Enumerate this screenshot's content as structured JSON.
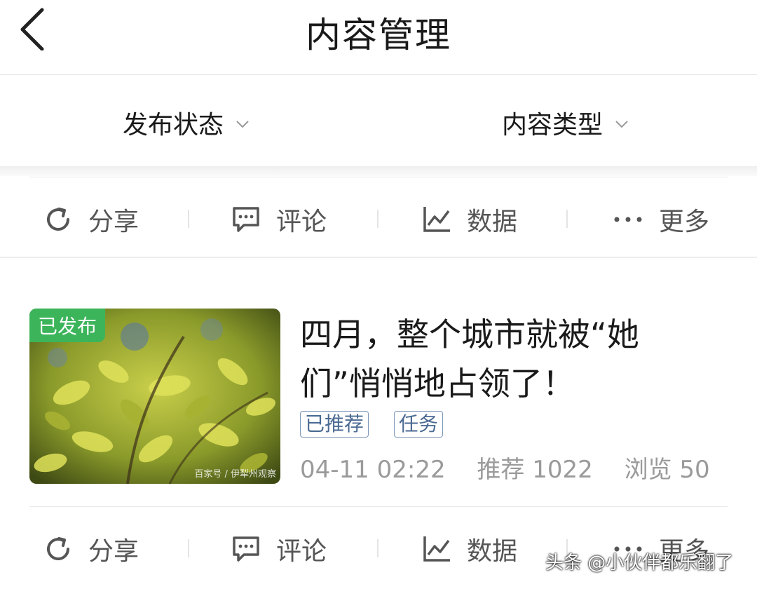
{
  "header": {
    "title": "内容管理"
  },
  "filters": [
    {
      "label": "发布状态"
    },
    {
      "label": "内容类型"
    }
  ],
  "actions": [
    {
      "label": "分享",
      "icon": "share-icon"
    },
    {
      "label": "评论",
      "icon": "comment-icon"
    },
    {
      "label": "数据",
      "icon": "chart-icon"
    },
    {
      "label": "更多",
      "icon": "more-icon"
    }
  ],
  "article": {
    "status_badge": "已发布",
    "title": "四月，整个城市就被“她们”悄悄地占领了！",
    "tags": [
      "已推荐",
      "任务"
    ],
    "time": "04-11 02:22",
    "recommend": "推荐 1022",
    "views": "浏览 50",
    "image_watermark": "百家号 / 伊犁州观察"
  },
  "watermark": "头条 @小伙伴都乐翻了",
  "colors": {
    "accent_green": "#3cb45a",
    "tag_blue": "#4a6a92",
    "meta_gray": "#9a9a9a"
  }
}
